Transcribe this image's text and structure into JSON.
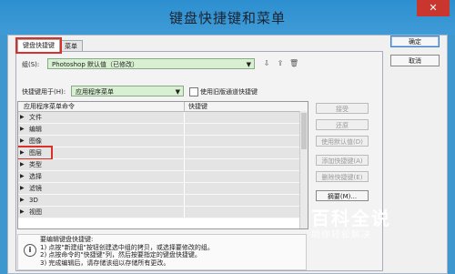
{
  "window": {
    "title": "键盘快捷键和菜单",
    "close_glyph": "✕"
  },
  "tabs": [
    {
      "label": "键盘快捷键",
      "active": true
    },
    {
      "label": "菜单",
      "active": false
    }
  ],
  "set_row": {
    "label": "组(S):",
    "value": "Photoshop 默认值（已修改）"
  },
  "shortcuts_for": {
    "label": "快捷键用于(H):",
    "value": "应用程序菜单",
    "checkbox_label": "使用旧版通道快捷键"
  },
  "table": {
    "col_command": "应用程序菜单命令",
    "col_shortcut": "快捷键",
    "rows": [
      "文件",
      "编辑",
      "图像",
      "图层",
      "类型",
      "选择",
      "滤镜",
      "3D",
      "视图"
    ],
    "highlighted_row": "图层"
  },
  "side_buttons": {
    "accept": "接受",
    "undo": "还原",
    "use_default": "使用默认值(D)",
    "add_shortcut": "添加快捷键(A)",
    "delete_shortcut": "删除快捷键(E)",
    "summarize": "摘要(M)..."
  },
  "main_buttons": {
    "ok": "确定",
    "cancel": "取消"
  },
  "info": {
    "heading": "要编辑键盘快捷键:",
    "step1": "1) 点按\"新建组\"按钮创建选中组的拷贝，或选择要修改的组。",
    "step2": "2) 点按命令的\"快捷键\"列，然后按要指定的键盘快捷键。",
    "step3": "3) 完成编辑后，请存储该组以存储所有更改。"
  },
  "watermark": {
    "line1": "百科全说",
    "line2": "助你轻松解决"
  }
}
